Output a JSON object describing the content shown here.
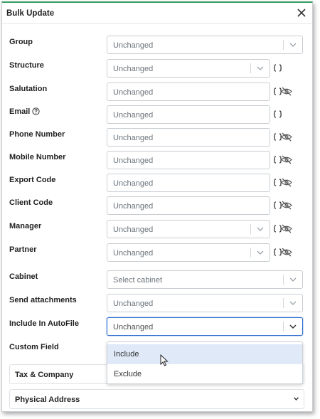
{
  "dialog": {
    "title": "Bulk Update"
  },
  "fields": [
    {
      "label": "Group",
      "value": "Unchanged"
    },
    {
      "label": "Structure",
      "value": "Unchanged"
    },
    {
      "label": "Salutation",
      "value": "Unchanged"
    },
    {
      "label": "Email",
      "value": "Unchanged"
    },
    {
      "label": "Phone Number",
      "value": "Unchanged"
    },
    {
      "label": "Mobile Number",
      "value": "Unchanged"
    },
    {
      "label": "Export Code",
      "value": "Unchanged"
    },
    {
      "label": "Client Code",
      "value": "Unchanged"
    },
    {
      "label": "Manager",
      "value": "Unchanged"
    },
    {
      "label": "Partner",
      "value": "Unchanged"
    },
    {
      "label": "Cabinet",
      "placeholder": "Select cabinet"
    },
    {
      "label": "Send attachments",
      "value": "Unchanged"
    },
    {
      "label": "Include In AutoFile",
      "value": "Unchanged"
    },
    {
      "label": "Custom Field"
    }
  ],
  "dropdown": {
    "options": [
      "Include",
      "Exclude"
    ],
    "hovered": "Include"
  },
  "sections": [
    {
      "label": "Tax & Company"
    },
    {
      "label": "Physical Address"
    }
  ],
  "icons": {
    "close": "close-icon",
    "help": "help-circle-icon",
    "variable": "curly-braces-icon",
    "hide": "eye-slash-icon",
    "chevron": "chevron-down-icon",
    "cursor": "mouse-pointer-icon"
  },
  "colors": {
    "accent_top_border": "#3aa065",
    "focus_border": "#2f6fd0",
    "option_hover": "#dfe9f8"
  }
}
